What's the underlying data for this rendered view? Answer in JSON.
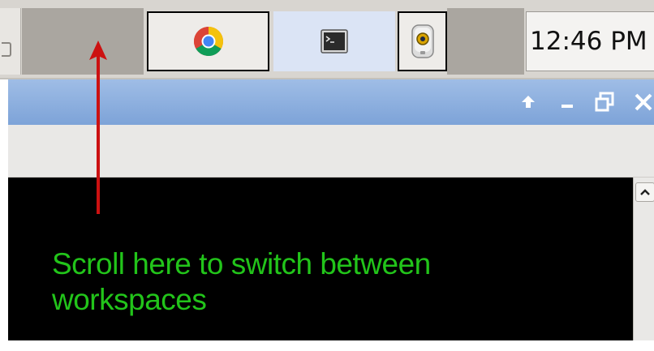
{
  "taskbar": {
    "workspace_area": "workspace-switcher",
    "tasks": [
      {
        "name": "chrome",
        "icon": "chrome-icon",
        "active": false
      },
      {
        "name": "terminal",
        "icon": "terminal-icon",
        "active": true
      },
      {
        "name": "image-viewer",
        "icon": "image-viewer-icon",
        "active": false
      }
    ],
    "clock": "12:46 PM"
  },
  "window": {
    "controls": [
      "up-arrow-icon",
      "minimize-icon",
      "restore-icon",
      "close-icon"
    ],
    "terminal_background": "#000000",
    "scrollbar": "scroll-up-icon"
  },
  "annotation": {
    "line1": "Scroll here to switch between",
    "line2": "workspaces",
    "text_color": "#22c41a",
    "arrow_color": "#cc1111"
  }
}
